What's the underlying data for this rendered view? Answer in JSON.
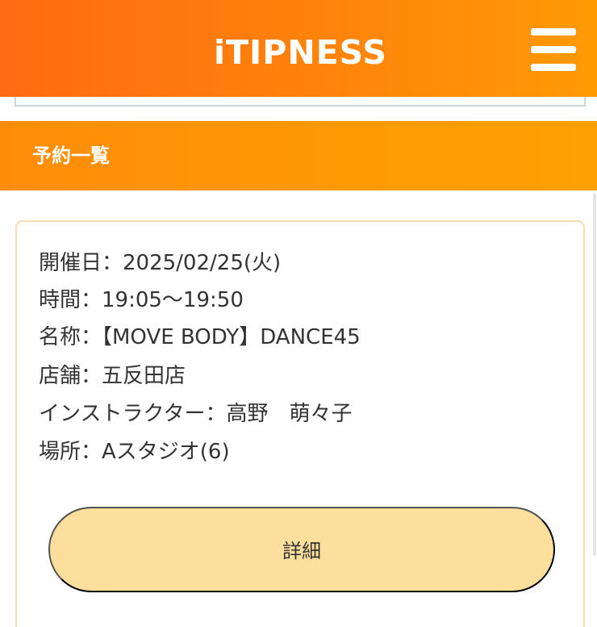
{
  "app": {
    "brand": "iTIPNESS"
  },
  "section": {
    "title": "予約一覧"
  },
  "reservation": {
    "date": "開催日：2025/02/25(火)",
    "time": "時間：19:05〜19:50",
    "name": "名称：【MOVE BODY】DANCE45",
    "store": "店舗：五反田店",
    "instructor": "インストラクター：高野　萌々子",
    "location": "場所：Aスタジオ(6)",
    "detail_button": "詳細"
  },
  "icons": {
    "menu": "hamburger-menu-icon"
  },
  "colors": {
    "header_start": "#ff6a12",
    "header_end": "#ff9a05",
    "section_bar": "#ff9a05",
    "card_border": "#f7deaf",
    "button": "#fddf9d",
    "text": "#333333"
  }
}
